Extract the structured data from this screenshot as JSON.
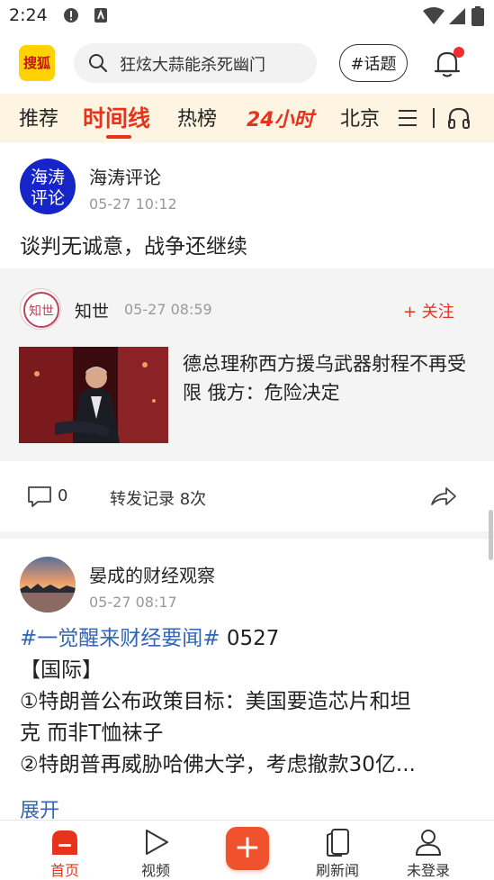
{
  "status_bar": {
    "time": "2:24"
  },
  "header": {
    "logo_text": "搜狐",
    "search_placeholder": "狂炫大蒜能杀死幽门",
    "topic_button": "#话题"
  },
  "tabs": [
    {
      "label": "推荐"
    },
    {
      "label": "时间线",
      "active": true
    },
    {
      "label": "热榜"
    },
    {
      "label": "24小时"
    },
    {
      "label": "北京"
    }
  ],
  "feed": {
    "post1": {
      "author": "海涛评论",
      "avatar_text": "海涛评论",
      "time": "05-27 10:12",
      "text": "谈判无诚意，战争还继续"
    },
    "quoted": {
      "author": "知世",
      "avatar_text": "知世",
      "time": "05-27 08:59",
      "follow_label": "+ 关注",
      "title": "德总理称西方援乌武器射程不再受限 俄方：危险决定"
    },
    "actions": {
      "comment_count": "0",
      "repost_text": "转发记录 8次"
    },
    "post3": {
      "author": "晏成的财经观察",
      "time": "05-27 08:17",
      "hashtag": "#一觉醒来财经要闻#",
      "hashtag_suffix": " 0527",
      "lines": [
        "【国际】",
        "①特朗普公布政策目标：美国要造芯片和坦",
        "克 而非T恤袜子",
        "②特朗普再威胁哈佛大学，考虑撤款30亿..."
      ],
      "expand_label": "展开"
    }
  },
  "bottom_nav": [
    {
      "label": "首页",
      "icon": "home-icon",
      "active": true
    },
    {
      "label": "视频",
      "icon": "play-icon"
    },
    {
      "label": "",
      "icon": "plus-icon"
    },
    {
      "label": "刷新闻",
      "icon": "cards-icon"
    },
    {
      "label": "未登录",
      "icon": "user-icon"
    }
  ],
  "colors": {
    "accent": "#e8331c",
    "tab_bar_bg": "#fdf5e2",
    "hashtag": "#3366b3"
  }
}
